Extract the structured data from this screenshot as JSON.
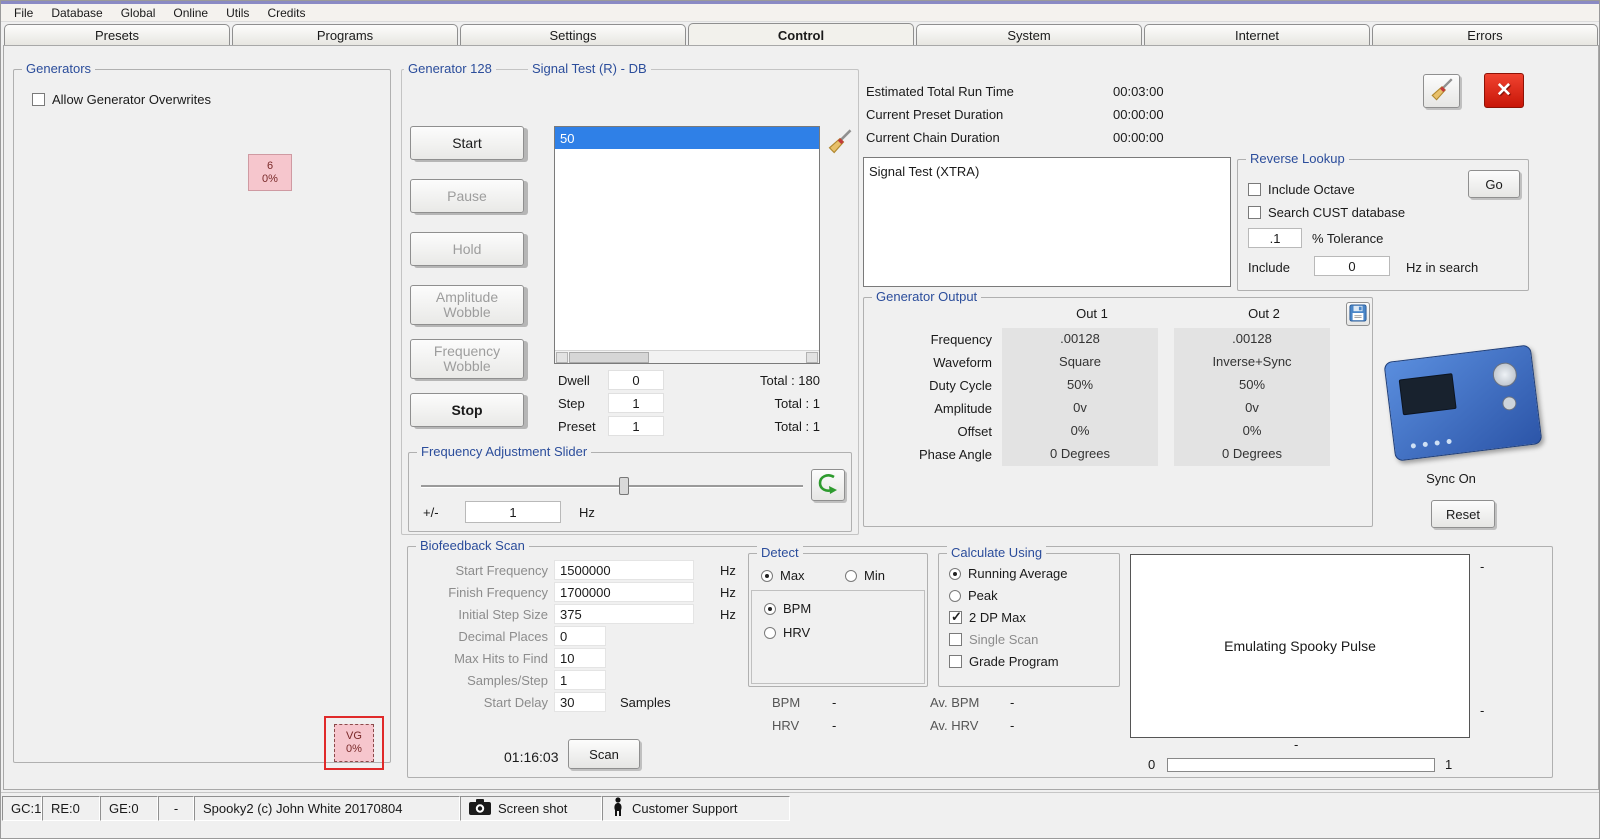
{
  "menu": {
    "items": [
      "File",
      "Database",
      "Global",
      "Online",
      "Utils",
      "Credits"
    ]
  },
  "tabs": [
    "Presets",
    "Programs",
    "Settings",
    "Control",
    "System",
    "Internet",
    "Errors"
  ],
  "icons": {
    "close": "✕"
  },
  "generators_panel": {
    "title": "Generators",
    "overwrite_label": "Allow Generator Overwrites",
    "overwrite_checked": false,
    "badge1": {
      "line1": "6",
      "line2": "0%"
    },
    "badge2": {
      "line1": "VG",
      "line2": "0%"
    }
  },
  "generator_panel": {
    "title": "Generator 128",
    "subtitle": "Signal Test (R) - DB",
    "buttons": {
      "start": "Start",
      "pause": "Pause",
      "hold": "Hold",
      "amplitude_wobble": "Amplitude Wobble",
      "frequency_wobble": "Frequency Wobble",
      "stop": "Stop"
    },
    "list_selected": "50",
    "counters": [
      {
        "label": "Dwell",
        "value": "0",
        "total": "Total : 180"
      },
      {
        "label": "Step",
        "value": "1",
        "total": "Total : 1"
      },
      {
        "label": "Preset",
        "value": "1",
        "total": "Total : 1"
      }
    ],
    "freq_slider": {
      "title": "Frequency Adjustment Slider",
      "plusminus": "+/-",
      "value": "1",
      "unit": "Hz"
    }
  },
  "run_info": {
    "rows": [
      {
        "label": "Estimated Total Run Time",
        "value": "00:03:00"
      },
      {
        "label": "Current Preset Duration",
        "value": "00:00:00"
      },
      {
        "label": "Current Chain Duration",
        "value": "00:00:00"
      }
    ]
  },
  "signal_box_text": "Signal Test (XTRA)",
  "reverse_lookup": {
    "title": "Reverse Lookup",
    "go": "Go",
    "include_octave": "Include Octave",
    "include_octave_checked": false,
    "search_cust": "Search CUST database",
    "search_cust_checked": false,
    "tolerance_value": ".1",
    "tolerance_label": "% Tolerance",
    "include_label": "Include",
    "include_value": "0",
    "include_suffix": "Hz in search"
  },
  "generator_output": {
    "title": "Generator Output",
    "col1": "Out 1",
    "col2": "Out 2",
    "rows": [
      {
        "label": "Frequency",
        "out1": ".00128",
        "out2": ".00128"
      },
      {
        "label": "Waveform",
        "out1": "Square",
        "out2": "Inverse+Sync"
      },
      {
        "label": "Duty Cycle",
        "out1": "50%",
        "out2": "50%"
      },
      {
        "label": "Amplitude",
        "out1": "0v",
        "out2": "0v"
      },
      {
        "label": "Offset",
        "out1": "0%",
        "out2": "0%"
      },
      {
        "label": "Phase Angle",
        "out1": "0 Degrees",
        "out2": "0 Degrees"
      }
    ]
  },
  "device": {
    "sync_label": "Sync On",
    "reset_label": "Reset"
  },
  "biofeedback": {
    "title": "Biofeedback Scan",
    "fields": [
      {
        "label": "Start Frequency",
        "value": "1500000",
        "suffix": "Hz"
      },
      {
        "label": "Finish Frequency",
        "value": "1700000",
        "suffix": "Hz"
      },
      {
        "label": "Initial Step Size",
        "value": "375",
        "suffix": "Hz"
      },
      {
        "label": "Decimal Places",
        "value": "0",
        "suffix": ""
      },
      {
        "label": "Max Hits to Find",
        "value": "10",
        "suffix": ""
      },
      {
        "label": "Samples/Step",
        "value": "1",
        "suffix": ""
      },
      {
        "label": "Start Delay",
        "value": "30",
        "suffix": "Samples"
      }
    ],
    "time": "01:16:03",
    "scan": "Scan",
    "detect": {
      "title": "Detect",
      "max": "Max",
      "max_selected": true,
      "min": "Min",
      "min_selected": false,
      "bpm": "BPM",
      "bpm_selected": true,
      "hrv": "HRV",
      "hrv_selected": false
    },
    "calculate": {
      "title": "Calculate Using",
      "options": [
        "Running Average",
        "Peak",
        "2 DP Max",
        "Single Scan",
        "Grade Program"
      ],
      "running_selected": true,
      "peak_selected": false,
      "dpmax_checked": true,
      "single_checked": false,
      "grade_checked": false
    },
    "bpm_label": "BPM",
    "bpm_value": "-",
    "hrv_label": "HRV",
    "hrv_value": "-",
    "av_bpm_label": "Av. BPM",
    "av_bpm_value": "-",
    "av_hrv_label": "Av. HRV",
    "av_hrv_value": "-",
    "pulse_box_text": "Emulating Spooky Pulse",
    "dash": "-",
    "progress_min": "0",
    "progress_max": "1"
  },
  "status_bar": {
    "cells": [
      "GC:1",
      "RE:0",
      "GE:0",
      "-",
      "Spooky2 (c) John White 20170804"
    ],
    "screenshot_label": "Screen shot",
    "support_label": "Customer Support"
  }
}
